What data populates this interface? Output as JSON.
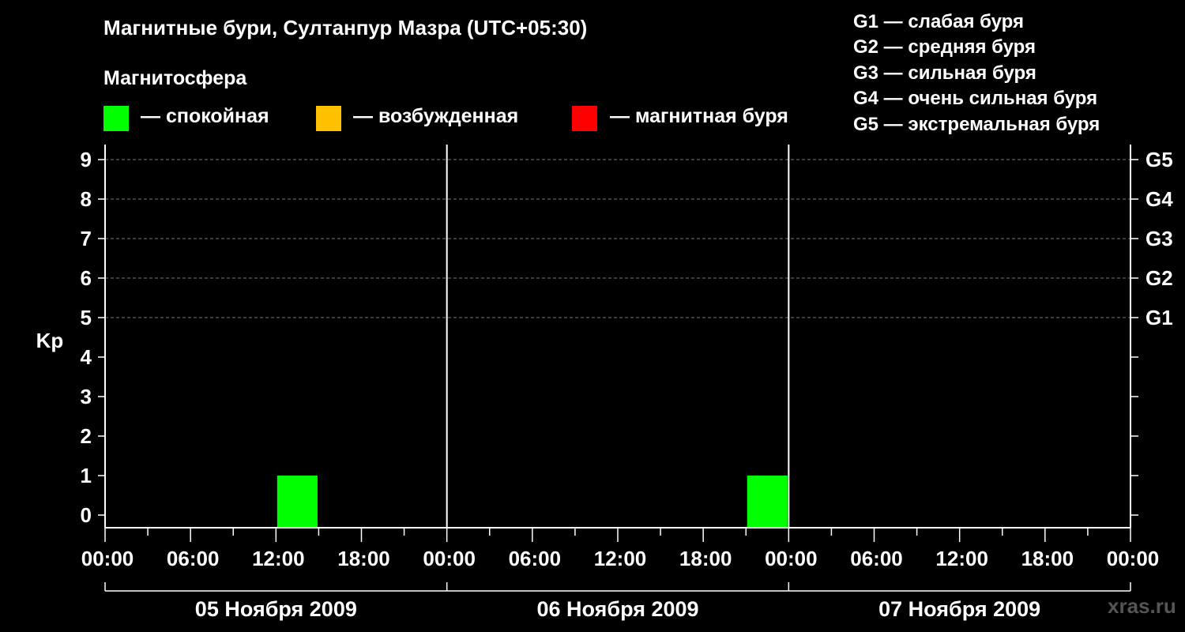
{
  "title": "Магнитные бури, Султанпур Мазра (UTC+05:30)",
  "magnetosphere_heading": "Магнитосфера",
  "legend": [
    {
      "label": "— спокойная",
      "color": "#00ff00"
    },
    {
      "label": "— возбужденная",
      "color": "#ffc000"
    },
    {
      "label": "— магнитная буря",
      "color": "#ff0000"
    }
  ],
  "g_scale_legend": [
    "G1 — слабая буря",
    "G2 — средняя буря",
    "G3 — сильная буря",
    "G4 — очень сильная буря",
    "G5 — экстремальная буря"
  ],
  "watermark": "xras.ru",
  "chart_data": {
    "type": "bar",
    "ylabel": "Kp",
    "ylim": [
      0,
      9
    ],
    "y_ticks": [
      "0",
      "1",
      "2",
      "3",
      "4",
      "5",
      "6",
      "7",
      "8",
      "9"
    ],
    "right_axis_ticks": [
      {
        "kp": 5,
        "label": "G1"
      },
      {
        "kp": 6,
        "label": "G2"
      },
      {
        "kp": 7,
        "label": "G3"
      },
      {
        "kp": 8,
        "label": "G4"
      },
      {
        "kp": 9,
        "label": "G5"
      }
    ],
    "x_tick_labels": [
      "00:00",
      "06:00",
      "12:00",
      "18:00",
      "00:00",
      "06:00",
      "12:00",
      "18:00",
      "00:00",
      "06:00",
      "12:00",
      "18:00",
      "00:00"
    ],
    "days": [
      "05 Ноября 2009",
      "06 Ноября 2009",
      "07 Ноября 2009"
    ],
    "grid": "dashed horizontal at Kp 5–9",
    "bars": [
      {
        "day": "05 Ноября 2009",
        "start": "12:00",
        "end": "15:00",
        "kp": 1,
        "level": "спокойная"
      },
      {
        "day": "06 Ноября 2009",
        "start": "21:00",
        "end": "24:00",
        "kp": 1,
        "level": "спокойная"
      }
    ],
    "level_colors": {
      "спокойная": "#00ff00",
      "возбужденная": "#ffc000",
      "магнитная буря": "#ff0000"
    }
  }
}
